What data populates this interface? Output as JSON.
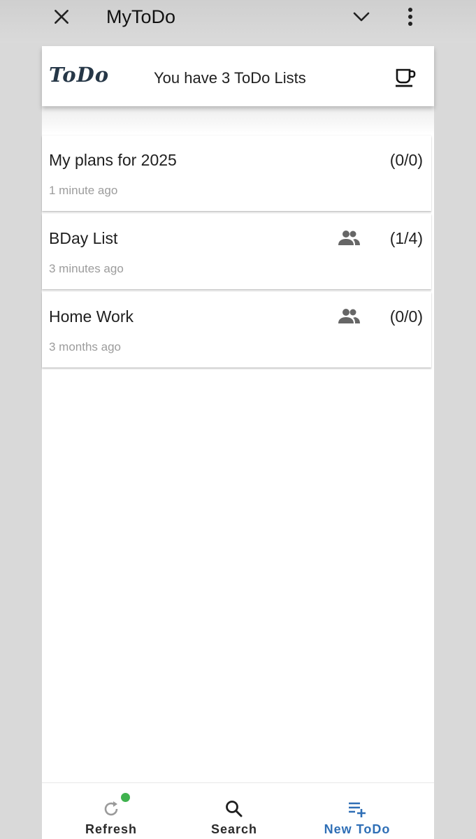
{
  "topbar": {
    "title": "MyToDo",
    "close_icon": "close-icon",
    "dropdown_icon": "chevron-down-icon",
    "menu_icon": "more-vert-icon"
  },
  "header": {
    "logo_text": "ToDo",
    "summary": "You have 3 ToDo Lists",
    "action_icon": "coffee-cup-icon"
  },
  "lists": [
    {
      "name": "My plans for 2025",
      "time": "1 minute ago",
      "count": "(0/0)",
      "shared": false
    },
    {
      "name": "BDay List",
      "time": "3 minutes ago",
      "count": "(1/4)",
      "shared": true
    },
    {
      "name": "Home Work",
      "time": "3 months ago",
      "count": "(0/0)",
      "shared": true
    }
  ],
  "nav": {
    "refresh_label": "Refresh",
    "search_label": "Search",
    "new_label": "New ToDo",
    "active": "new_todo"
  },
  "colors": {
    "accent": "#2f6fb6",
    "badge": "#3fb24e",
    "logo": "#263747"
  }
}
